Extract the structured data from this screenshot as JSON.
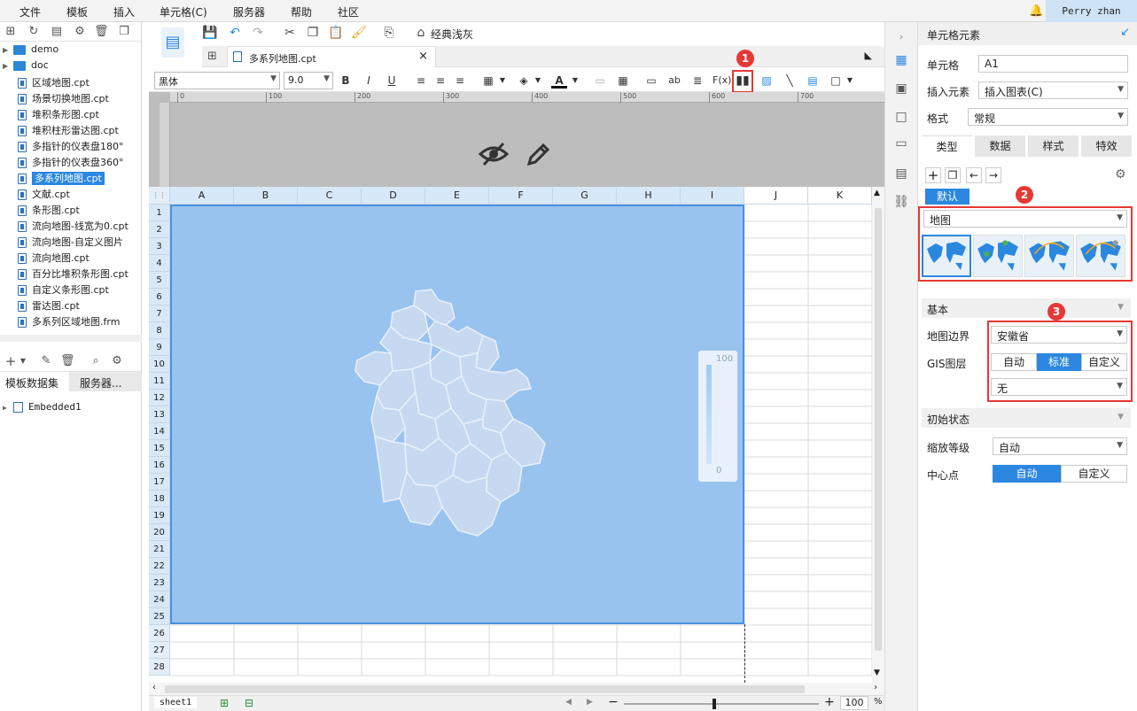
{
  "menubar": {
    "items": [
      "文件",
      "模板",
      "插入",
      "单元格(C)",
      "服务器",
      "帮助",
      "社区"
    ],
    "user": "Perry zhan"
  },
  "tree": {
    "folders": [
      "demo",
      "doc"
    ],
    "files": [
      "区域地图.cpt",
      "场景切换地图.cpt",
      "堆积条形图.cpt",
      "堆积柱形雷达图.cpt",
      "多指针的仪表盘180°",
      "多指针的仪表盘360°",
      "多系列地图.cpt",
      "文献.cpt",
      "条形图.cpt",
      "流向地图-线宽为0.cpt",
      "流向地图-自定义图片",
      "流向地图.cpt",
      "百分比堆积条形图.cpt",
      "自定义条形图.cpt",
      "雷达图.cpt",
      "多系列区域地图.frm"
    ],
    "selected_index": 6
  },
  "dataset_tabs": [
    "模板数据集",
    "服务器..."
  ],
  "dataset_item": "Embedded1",
  "toolbar": {
    "classic_label": "经典浅灰"
  },
  "doc_tab": {
    "title": "多系列地图.cpt"
  },
  "format": {
    "font": "黑体",
    "size": "9.0"
  },
  "ruler_ticks": [
    "0",
    "100",
    "200",
    "300",
    "400",
    "500",
    "600",
    "700"
  ],
  "columns": [
    "A",
    "B",
    "C",
    "D",
    "E",
    "F",
    "G",
    "H",
    "I",
    "J",
    "K"
  ],
  "rows": [
    "1",
    "2",
    "3",
    "4",
    "5",
    "6",
    "7",
    "8",
    "9",
    "10",
    "11",
    "12",
    "13",
    "14",
    "15",
    "16",
    "17",
    "18",
    "19",
    "20",
    "21",
    "22",
    "23",
    "24",
    "25",
    "26",
    "27",
    "28"
  ],
  "legend": {
    "max": "100",
    "min": "0"
  },
  "status": {
    "sheet": "sheet1",
    "zoom": "100",
    "pct": "%"
  },
  "panel": {
    "title": "单元格元素",
    "cell_label": "单元格",
    "cell_value": "A1",
    "insert_label": "插入元素",
    "insert_value": "插入图表(C)",
    "format_label": "格式",
    "format_value": "常规",
    "tabs": [
      "类型",
      "数据",
      "样式",
      "特效"
    ],
    "default_tag": "默认",
    "chart_type": "地图",
    "basic_section": "基本",
    "map_boundary_label": "地图边界",
    "map_boundary_value": "安徽省",
    "gis_label": "GIS图层",
    "gis_options": [
      "自动",
      "标准",
      "自定义"
    ],
    "gis_active": 1,
    "gis_none": "无",
    "initial_section": "初始状态",
    "zoom_label": "缩放等级",
    "zoom_value": "自动",
    "center_label": "中心点",
    "center_options": [
      "自动",
      "自定义"
    ]
  },
  "badges": [
    "1",
    "2",
    "3"
  ],
  "colors": {
    "accent": "#2b87e0",
    "map_bg": "#98c3ee",
    "map_fill": "#c6d9f0",
    "highlight": "#e53935"
  }
}
